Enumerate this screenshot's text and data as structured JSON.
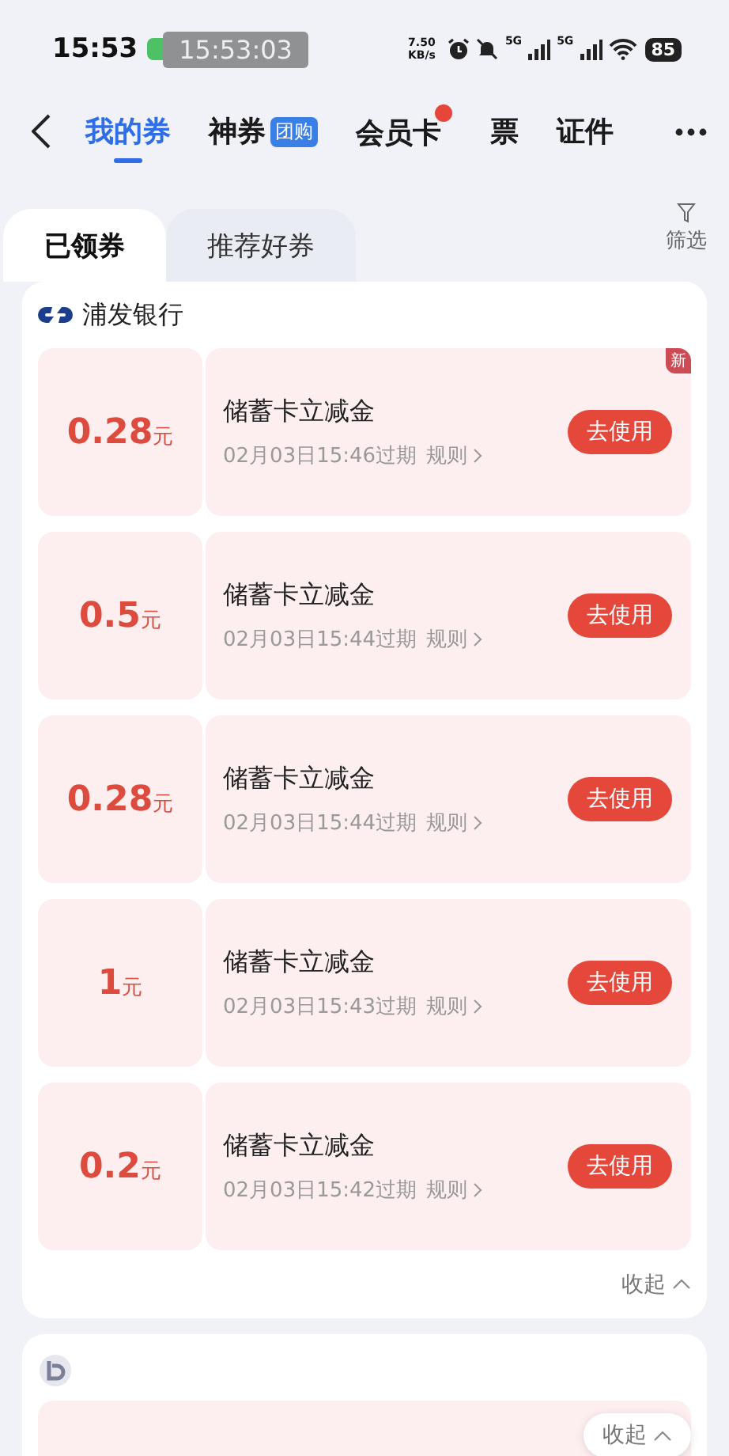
{
  "status_bar": {
    "time": "15:53",
    "clock_badge": "15:53:03",
    "net_speed": "7.50",
    "net_unit": "KB/s",
    "signal_1": "5G",
    "signal_2": "5G",
    "battery": "85"
  },
  "nav": {
    "tabs": [
      {
        "label": "我的券",
        "selected": true,
        "dot": false
      },
      {
        "label": "神券",
        "badge": "团购",
        "selected": false,
        "dot": false
      },
      {
        "label": "会员卡",
        "selected": false,
        "dot": true
      },
      {
        "label": "票",
        "selected": false,
        "dot": false
      },
      {
        "label": "证件",
        "selected": false,
        "dot": false
      }
    ]
  },
  "sub_tabs": [
    {
      "label": "已领券",
      "selected": true
    },
    {
      "label": "推荐好券",
      "selected": false
    }
  ],
  "filter": {
    "label": "筛选"
  },
  "bank_groups": [
    {
      "name": "浦发银行",
      "collapse": "收起",
      "coupons": [
        {
          "amount": "0.28",
          "unit": "元",
          "title": "储蓄卡立减金",
          "expiry": "02月03日15:46过期",
          "rules": "规则",
          "button": "去使用",
          "is_new": true,
          "new_label": "新"
        },
        {
          "amount": "0.5",
          "unit": "元",
          "title": "储蓄卡立减金",
          "expiry": "02月03日15:44过期",
          "rules": "规则",
          "button": "去使用",
          "is_new": false
        },
        {
          "amount": "0.28",
          "unit": "元",
          "title": "储蓄卡立减金",
          "expiry": "02月03日15:44过期",
          "rules": "规则",
          "button": "去使用",
          "is_new": false
        },
        {
          "amount": "1",
          "unit": "元",
          "title": "储蓄卡立减金",
          "expiry": "02月03日15:43过期",
          "rules": "规则",
          "button": "去使用",
          "is_new": false
        },
        {
          "amount": "0.2",
          "unit": "元",
          "title": "储蓄卡立减金",
          "expiry": "02月03日15:42过期",
          "rules": "规则",
          "button": "去使用",
          "is_new": false
        }
      ]
    }
  ],
  "floating_collapse": {
    "label": "收起"
  }
}
